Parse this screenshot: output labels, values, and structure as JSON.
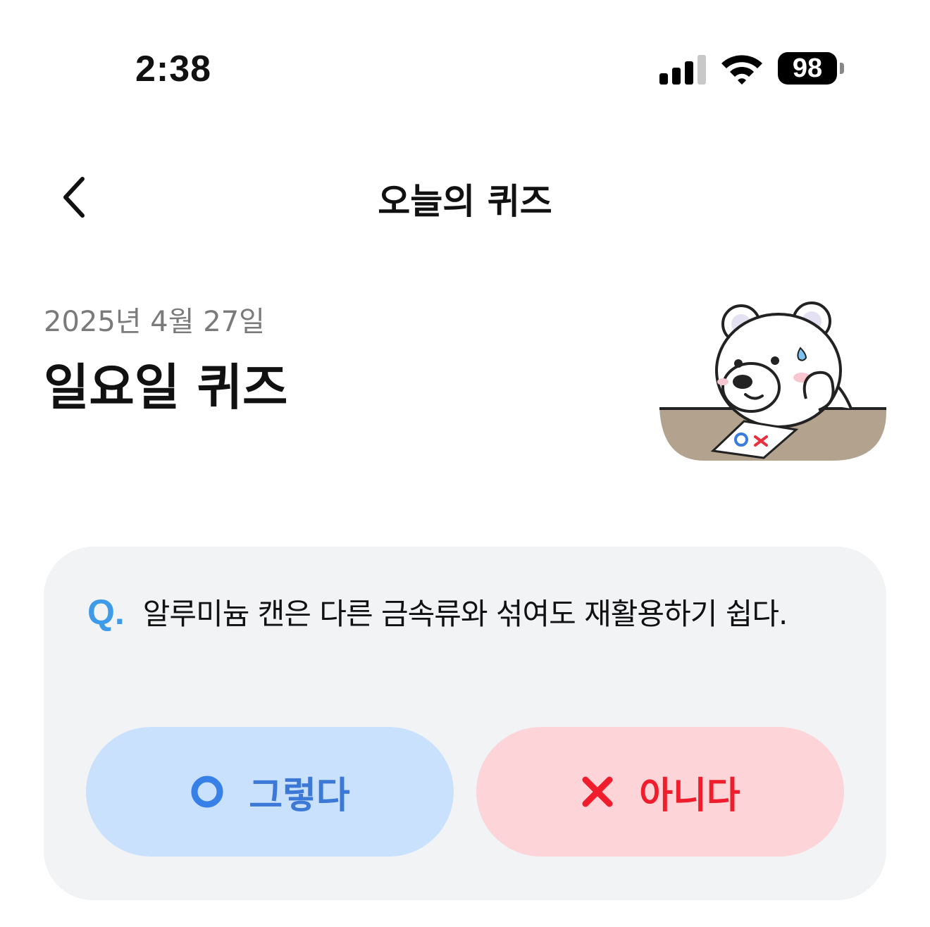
{
  "status_bar": {
    "time": "2:38",
    "battery": "98",
    "icons": [
      "cellular-signal-icon",
      "wifi-icon",
      "battery-icon"
    ]
  },
  "header": {
    "back_icon": "chevron-left-icon",
    "title": "오늘의 퀴즈"
  },
  "quiz": {
    "date": "2025년 4월 27일",
    "title": "일요일 퀴즈",
    "mascot": "polar-bear-with-ox-card-illustration",
    "question_prefix": "Q.",
    "question": "알루미늄 캔은 다른 금속류와 섞여도 재활용하기 쉽다.",
    "answers": {
      "yes_label": "그렇다",
      "yes_icon": "circle-o-icon",
      "no_label": "아니다",
      "no_icon": "x-mark-icon"
    }
  },
  "colors": {
    "q_mark": "#3d9be9",
    "yes_bg": "#c9e1fd",
    "yes_text": "#3c79d6",
    "no_bg": "#fdd4d7",
    "no_text": "#f01e2c",
    "card_bg": "#f2f3f5"
  }
}
